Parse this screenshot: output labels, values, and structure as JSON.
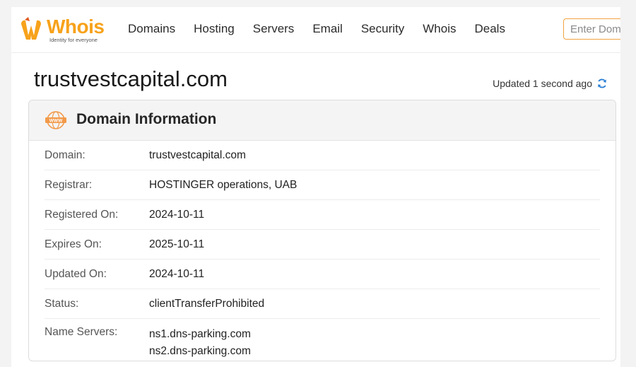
{
  "brand": {
    "name": "Whois",
    "tagline": "Identity for everyone",
    "color": "#f7a21b"
  },
  "nav": {
    "items": [
      "Domains",
      "Hosting",
      "Servers",
      "Email",
      "Security",
      "Whois",
      "Deals"
    ]
  },
  "search": {
    "placeholder": "Enter Domain or IP"
  },
  "title": "trustvestcapital.com",
  "updated": {
    "text": "Updated 1 second ago",
    "icon": "refresh-icon"
  },
  "card": {
    "title": "Domain Information",
    "icon": "www-globe-icon",
    "rows": [
      {
        "label": "Domain:",
        "value": "trustvestcapital.com"
      },
      {
        "label": "Registrar:",
        "value": "HOSTINGER operations, UAB"
      },
      {
        "label": "Registered On:",
        "value": "2024-10-11"
      },
      {
        "label": "Expires On:",
        "value": "2025-10-11"
      },
      {
        "label": "Updated On:",
        "value": "2024-10-11"
      },
      {
        "label": "Status:",
        "value": "clientTransferProhibited"
      }
    ],
    "name_servers": {
      "label": "Name Servers:",
      "values": [
        "ns1.dns-parking.com",
        "ns2.dns-parking.com"
      ]
    }
  }
}
